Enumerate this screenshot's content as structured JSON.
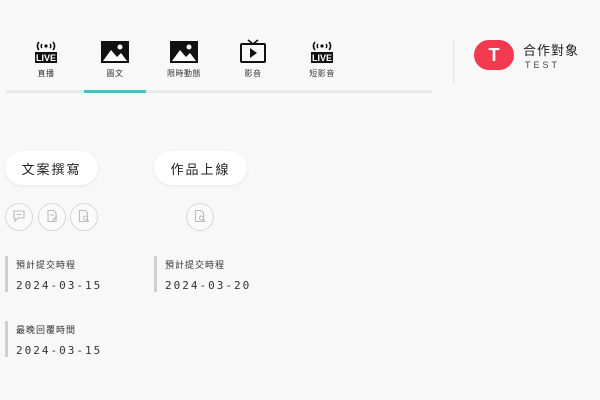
{
  "tabs": [
    {
      "label": "直播",
      "icon": "live-broadcast-icon",
      "badge": "LIVE"
    },
    {
      "label": "圖文",
      "icon": "image-icon",
      "active": true
    },
    {
      "label": "限時動態",
      "icon": "image-icon"
    },
    {
      "label": "影音",
      "icon": "tv-icon"
    },
    {
      "label": "短影音",
      "icon": "live-broadcast-icon",
      "badge": "LIVE"
    }
  ],
  "partner": {
    "heading": "合作對象",
    "name": "TEST",
    "avatar_letter": "T",
    "avatar_color": "#f2394f"
  },
  "accent_color": "#5ab9c2",
  "columns": [
    {
      "title": "文案撰寫",
      "actions": [
        "comment-icon",
        "edit-document-icon",
        "search-document-icon"
      ],
      "fields": [
        {
          "label": "預計提交時程",
          "value": "2024-03-15"
        },
        {
          "label": "最晚回覆時間",
          "value": "2024-03-15"
        }
      ]
    },
    {
      "title": "作品上線",
      "actions": [
        "search-document-icon"
      ],
      "fields": [
        {
          "label": "預計提交時程",
          "value": "2024-03-20"
        }
      ]
    }
  ]
}
